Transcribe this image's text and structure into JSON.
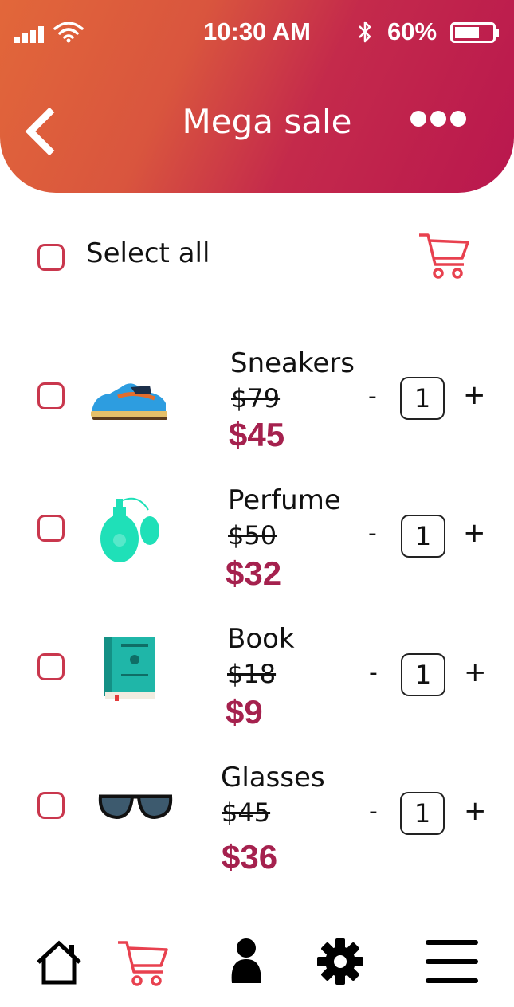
{
  "status": {
    "time": "10:30 AM",
    "battery": "60%"
  },
  "header": {
    "title": "Mega sale"
  },
  "select_all": {
    "label": "Select all"
  },
  "items": [
    {
      "name": "Sneakers",
      "old_price": "$79",
      "new_price": "$45",
      "qty": "1",
      "minus": "-",
      "plus": "+"
    },
    {
      "name": "Perfume",
      "old_price": "$50",
      "new_price": "$32",
      "qty": "1",
      "minus": "-",
      "plus": "+"
    },
    {
      "name": "Book",
      "old_price": "$18",
      "new_price": "$9",
      "qty": "1",
      "minus": "-",
      "plus": "+"
    },
    {
      "name": "Glasses",
      "old_price": "$45",
      "new_price": "$36",
      "qty": "1",
      "minus": "-",
      "plus": "+"
    }
  ],
  "colors": {
    "accent": "#c42a4b",
    "price": "#a5214e",
    "cart": "#e8414f"
  },
  "bottom_nav": [
    "home-icon",
    "cart-icon",
    "profile-icon",
    "settings-icon",
    "menu-icon"
  ]
}
